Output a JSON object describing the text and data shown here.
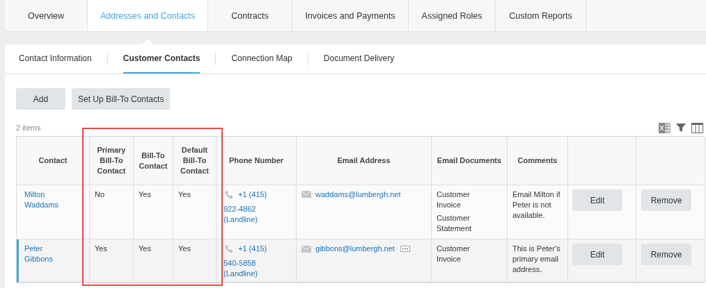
{
  "tabs": [
    {
      "label": "Overview",
      "selected": false
    },
    {
      "label": "Addresses and Contacts",
      "selected": true
    },
    {
      "label": "Contracts",
      "selected": false
    },
    {
      "label": "Invoices and Payments",
      "selected": false
    },
    {
      "label": "Assigned Roles",
      "selected": false
    },
    {
      "label": "Custom Reports",
      "selected": false
    }
  ],
  "subtabs": [
    {
      "label": "Contact Information",
      "selected": false
    },
    {
      "label": "Customer Contacts",
      "selected": true
    },
    {
      "label": "Connection Map",
      "selected": false
    },
    {
      "label": "Document Delivery",
      "selected": false
    }
  ],
  "buttons": [
    "Add",
    "Set Up Bill-To Contacts"
  ],
  "item_count": "2 items",
  "table": {
    "columns": [
      {
        "label": "Contact",
        "highlighted": false
      },
      {
        "label": "Primary Bill-To Contact",
        "highlighted": true
      },
      {
        "label": "Bill-To Contact",
        "highlighted": true
      },
      {
        "label": "Default Bill-To Contact",
        "highlighted": true
      },
      {
        "label": "Phone Number",
        "highlighted": false
      },
      {
        "label": "Email Address",
        "highlighted": false
      },
      {
        "label": "Email Documents",
        "highlighted": false
      },
      {
        "label": "Comments",
        "highlighted": false
      }
    ],
    "rows": [
      {
        "selected": false,
        "contact": "Milton Waddams",
        "primary": "No",
        "bill_to": "Yes",
        "default": "Yes",
        "phone_1": "+1 (415)",
        "phone_2": "922-4862 (Landline)",
        "email": "waddams@lumbergh.net",
        "more": false,
        "documents": [
          "Customer Invoice",
          "Customer Statement"
        ],
        "comments": "Email Milton if Peter is not available.",
        "actions": [
          "Edit",
          "Remove"
        ]
      },
      {
        "selected": true,
        "contact": "Peter Gibbons",
        "primary": "Yes",
        "bill_to": "Yes",
        "default": "Yes",
        "phone_1": "+1 (415)",
        "phone_2": "540-5858 (Landline)",
        "email": "gibbons@lumbergh.net",
        "more": true,
        "documents": [
          "Customer Invoice"
        ],
        "comments": "This is Peter's primary email address.",
        "actions": [
          "Edit",
          "Remove"
        ]
      }
    ]
  }
}
